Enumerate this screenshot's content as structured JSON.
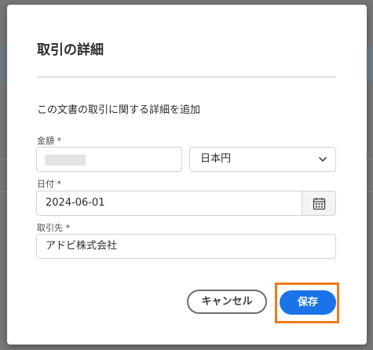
{
  "dialog": {
    "title": "取引の詳細",
    "description": "この文書の取引に関する詳細を追加"
  },
  "amount": {
    "label": "金額 *",
    "value": ""
  },
  "currency": {
    "selected": "日本円"
  },
  "date": {
    "label": "日付 *",
    "value": "2024-06-01"
  },
  "party": {
    "label": "取引先 *",
    "value": "アドビ株式会社"
  },
  "buttons": {
    "cancel": "キャンセル",
    "save": "保存"
  },
  "colors": {
    "primary": "#1a73e8",
    "highlight": "#f07a1a"
  },
  "icons": {
    "currency_dropdown": "chevron-down-icon",
    "date_picker": "calendar-icon"
  }
}
